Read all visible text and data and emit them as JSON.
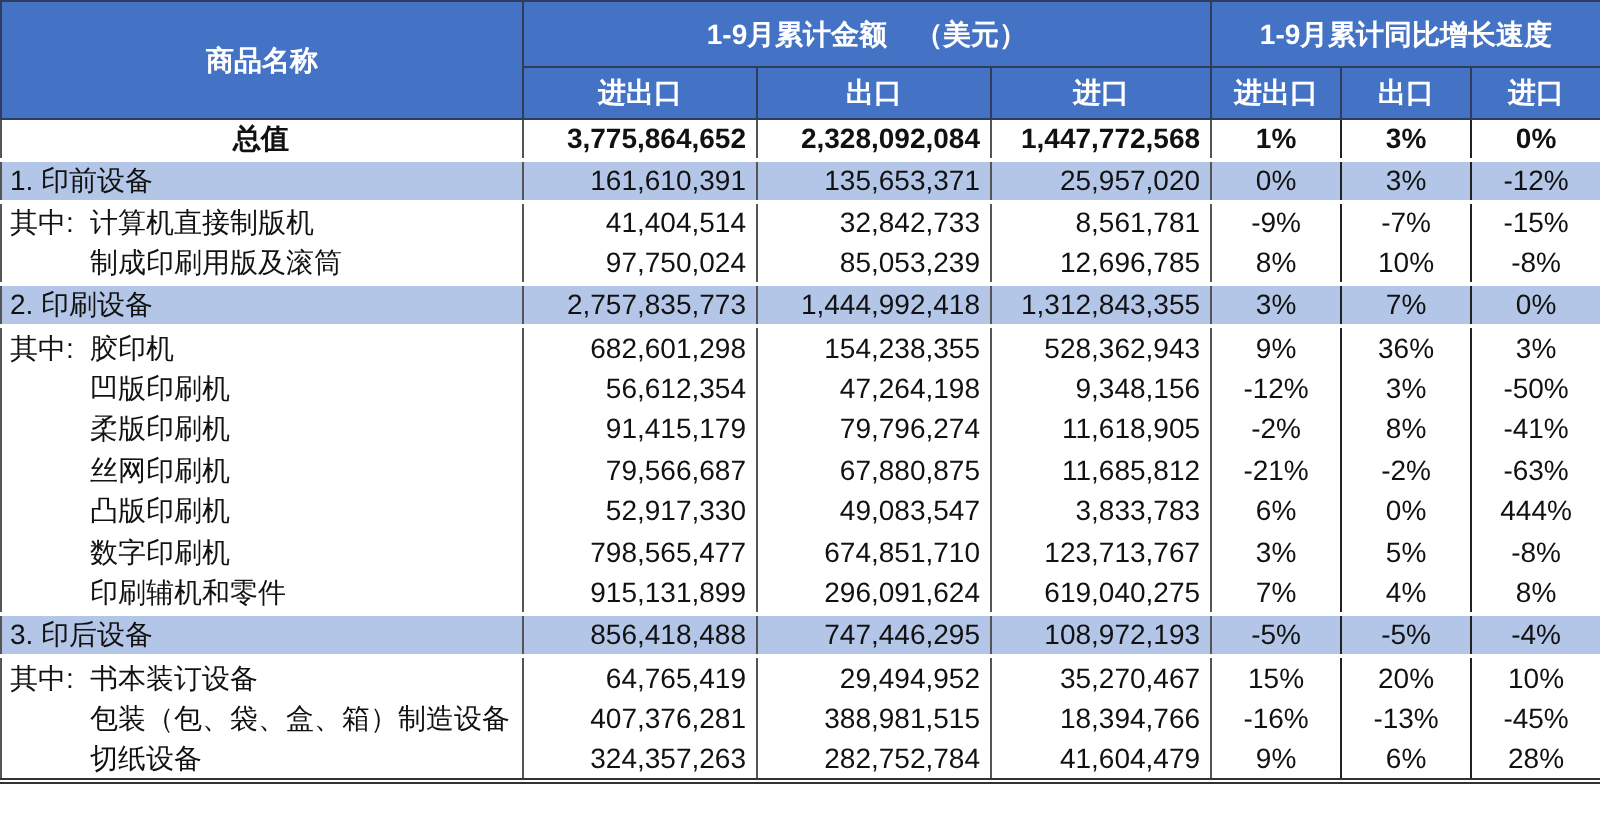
{
  "table": {
    "name_header": "商品名称",
    "groups": [
      "1-9月累计金额　（美元）",
      "1-9月累计同比增长速度"
    ],
    "columns": [
      "进出口",
      "出口",
      "进口",
      "进出口",
      "出口",
      "进口"
    ],
    "rows": [
      {
        "kind": "total",
        "name": "总值",
        "values": [
          "3,775,864,652",
          "2,328,092,084",
          "1,447,772,568",
          "1%",
          "3%",
          "0%"
        ]
      },
      {
        "kind": "category",
        "name": "1. 印前设备",
        "values": [
          "161,610,391",
          "135,653,371",
          "25,957,020",
          "0%",
          "3%",
          "-12%"
        ]
      },
      {
        "kind": "item",
        "prefix": "其中:",
        "name": "计算机直接制版机",
        "values": [
          "41,404,514",
          "32,842,733",
          "8,561,781",
          "-9%",
          "-7%",
          "-15%"
        ]
      },
      {
        "kind": "item",
        "name": "制成印刷用版及滚筒",
        "values": [
          "97,750,024",
          "85,053,239",
          "12,696,785",
          "8%",
          "10%",
          "-8%"
        ]
      },
      {
        "kind": "category",
        "name": "2. 印刷设备",
        "values": [
          "2,757,835,773",
          "1,444,992,418",
          "1,312,843,355",
          "3%",
          "7%",
          "0%"
        ]
      },
      {
        "kind": "item",
        "prefix": "其中:",
        "name": "胶印机",
        "values": [
          "682,601,298",
          "154,238,355",
          "528,362,943",
          "9%",
          "36%",
          "3%"
        ]
      },
      {
        "kind": "item",
        "name": "凹版印刷机",
        "values": [
          "56,612,354",
          "47,264,198",
          "9,348,156",
          "-12%",
          "3%",
          "-50%"
        ]
      },
      {
        "kind": "item",
        "name": "柔版印刷机",
        "values": [
          "91,415,179",
          "79,796,274",
          "11,618,905",
          "-2%",
          "8%",
          "-41%"
        ]
      },
      {
        "kind": "item",
        "name": "丝网印刷机",
        "values": [
          "79,566,687",
          "67,880,875",
          "11,685,812",
          "-21%",
          "-2%",
          "-63%"
        ]
      },
      {
        "kind": "item",
        "name": "凸版印刷机",
        "values": [
          "52,917,330",
          "49,083,547",
          "3,833,783",
          "6%",
          "0%",
          "444%"
        ]
      },
      {
        "kind": "item",
        "name": "数字印刷机",
        "values": [
          "798,565,477",
          "674,851,710",
          "123,713,767",
          "3%",
          "5%",
          "-8%"
        ]
      },
      {
        "kind": "item",
        "name": "印刷辅机和零件",
        "values": [
          "915,131,899",
          "296,091,624",
          "619,040,275",
          "7%",
          "4%",
          "8%"
        ]
      },
      {
        "kind": "category",
        "name": "3.  印后设备",
        "values": [
          "856,418,488",
          "747,446,295",
          "108,972,193",
          "-5%",
          "-5%",
          "-4%"
        ]
      },
      {
        "kind": "item",
        "prefix": "其中:",
        "name": "书本装订设备",
        "values": [
          "64,765,419",
          "29,494,952",
          "35,270,467",
          "15%",
          "20%",
          "10%"
        ]
      },
      {
        "kind": "item",
        "name": "包装（包、袋、盒、箱）制造设备",
        "values": [
          "407,376,281",
          "388,981,515",
          "18,394,766",
          "-16%",
          "-13%",
          "-45%"
        ]
      },
      {
        "kind": "item",
        "name": "切纸设备",
        "values": [
          "324,357,263",
          "282,752,784",
          "41,604,479",
          "9%",
          "6%",
          "28%"
        ]
      }
    ]
  }
}
